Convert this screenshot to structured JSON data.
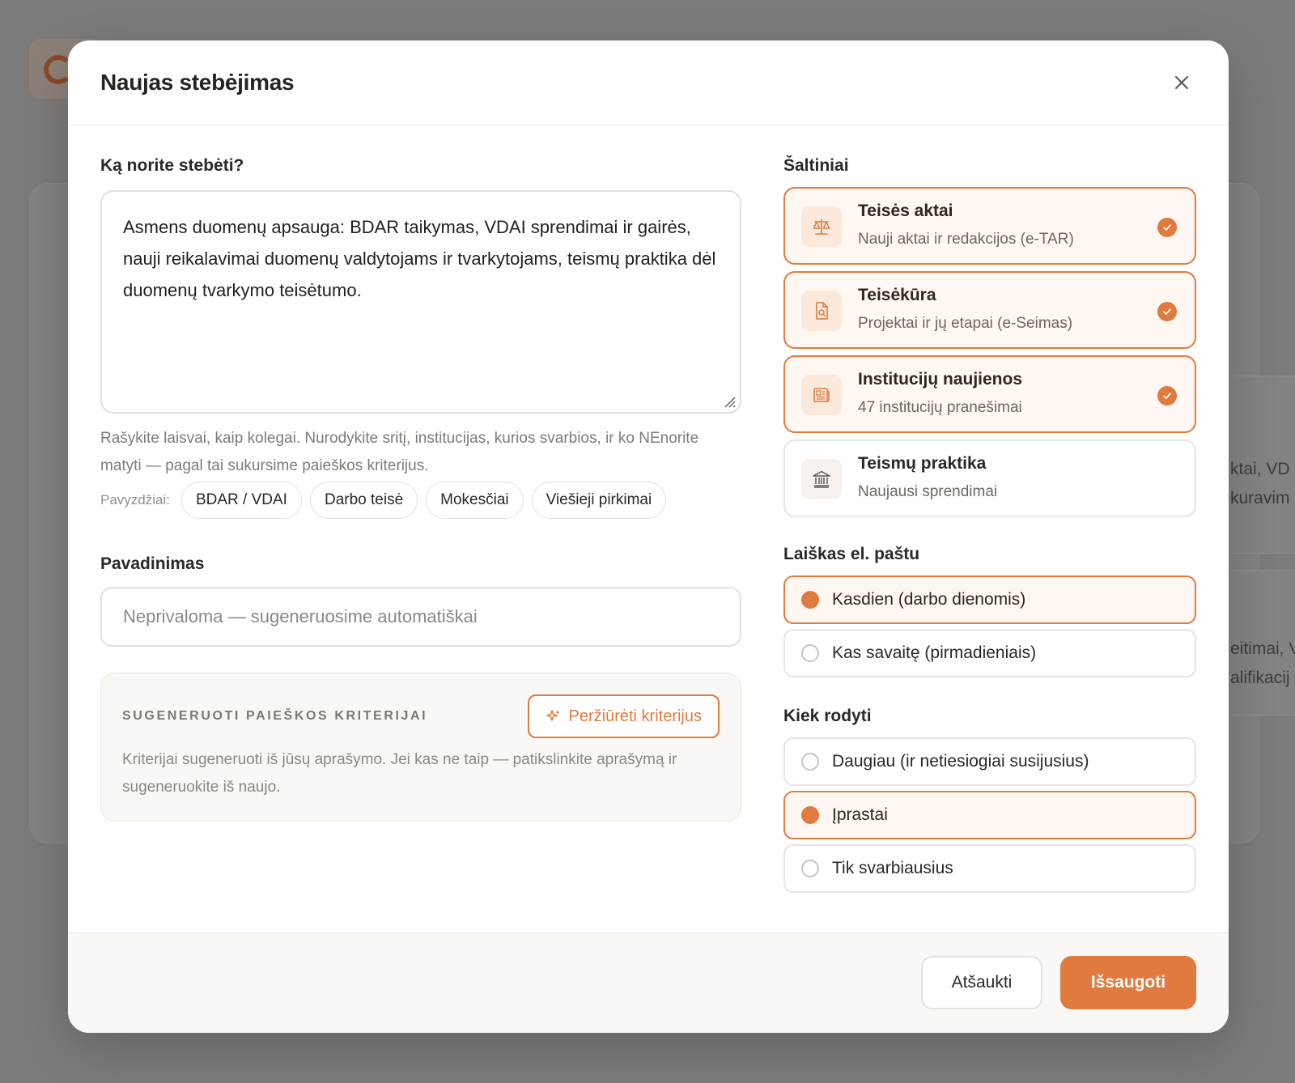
{
  "background": {
    "snippets": [
      "ktai, VD",
      "kuravim",
      "eitimai, V",
      "alifikacij"
    ]
  },
  "modal": {
    "title": "Naujas stebėjimas",
    "close_icon": "close-icon"
  },
  "topic": {
    "label": "Ką norite stebėti?",
    "value": "Asmens duomenų apsauga: BDAR taikymas, VDAI sprendimai ir gairės, nauji reikalavimai duomenų valdytojams ir tvarkytojams, teismų praktika dėl duomenų tvarkymo teisėtumo.",
    "helper": "Rašykite laisvai, kaip kolegai. Nurodykite sritį, institucijas, kurios svarbios, ir ko NEnorite matyti — pagal tai sukursime paieškos kriterijus.",
    "examples_label": "Pavyzdžiai:",
    "examples": [
      "BDAR / VDAI",
      "Darbo teisė",
      "Mokesčiai",
      "Viešieji pirkimai"
    ]
  },
  "name": {
    "label": "Pavadinimas",
    "placeholder": "Neprivaloma — sugeneruosime automatiškai",
    "value": ""
  },
  "criteria": {
    "title": "SUGENERUOTI PAIEŠKOS KRITERIJAI",
    "button_label": "Peržiūrėti kriterijus",
    "description": "Kriterijai sugeneruoti iš jūsų aprašymo. Jei kas ne taip — patikslinkite aprašymą ir sugeneruokite iš naujo."
  },
  "sources": {
    "label": "Šaltiniai",
    "items": [
      {
        "title": "Teisės aktai",
        "subtitle": "Nauji aktai ir redakcijos (e-TAR)",
        "icon": "scales-icon",
        "selected": true
      },
      {
        "title": "Teisėkūra",
        "subtitle": "Projektai ir jų etapai (e-Seimas)",
        "icon": "document-search-icon",
        "selected": true
      },
      {
        "title": "Institucijų naujienos",
        "subtitle": "47 institucijų pranešimai",
        "icon": "newspaper-icon",
        "selected": true
      },
      {
        "title": "Teismų praktika",
        "subtitle": "Naujausi sprendimai",
        "icon": "courthouse-icon",
        "selected": false
      }
    ]
  },
  "email": {
    "label": "Laiškas el. paštu",
    "options": [
      {
        "label": "Kasdien (darbo dienomis)",
        "selected": true
      },
      {
        "label": "Kas savaitę (pirmadieniais)",
        "selected": false
      }
    ]
  },
  "amount": {
    "label": "Kiek rodyti",
    "options": [
      {
        "label": "Daugiau (ir netiesiogiai susijusius)",
        "selected": false
      },
      {
        "label": "Įprastai",
        "selected": true
      },
      {
        "label": "Tik svarbiausius",
        "selected": false
      }
    ]
  },
  "footer": {
    "cancel_label": "Atšaukti",
    "save_label": "Išsaugoti"
  },
  "colors": {
    "accent": "#e07a3f",
    "selected_bg": "#fff7f1"
  }
}
